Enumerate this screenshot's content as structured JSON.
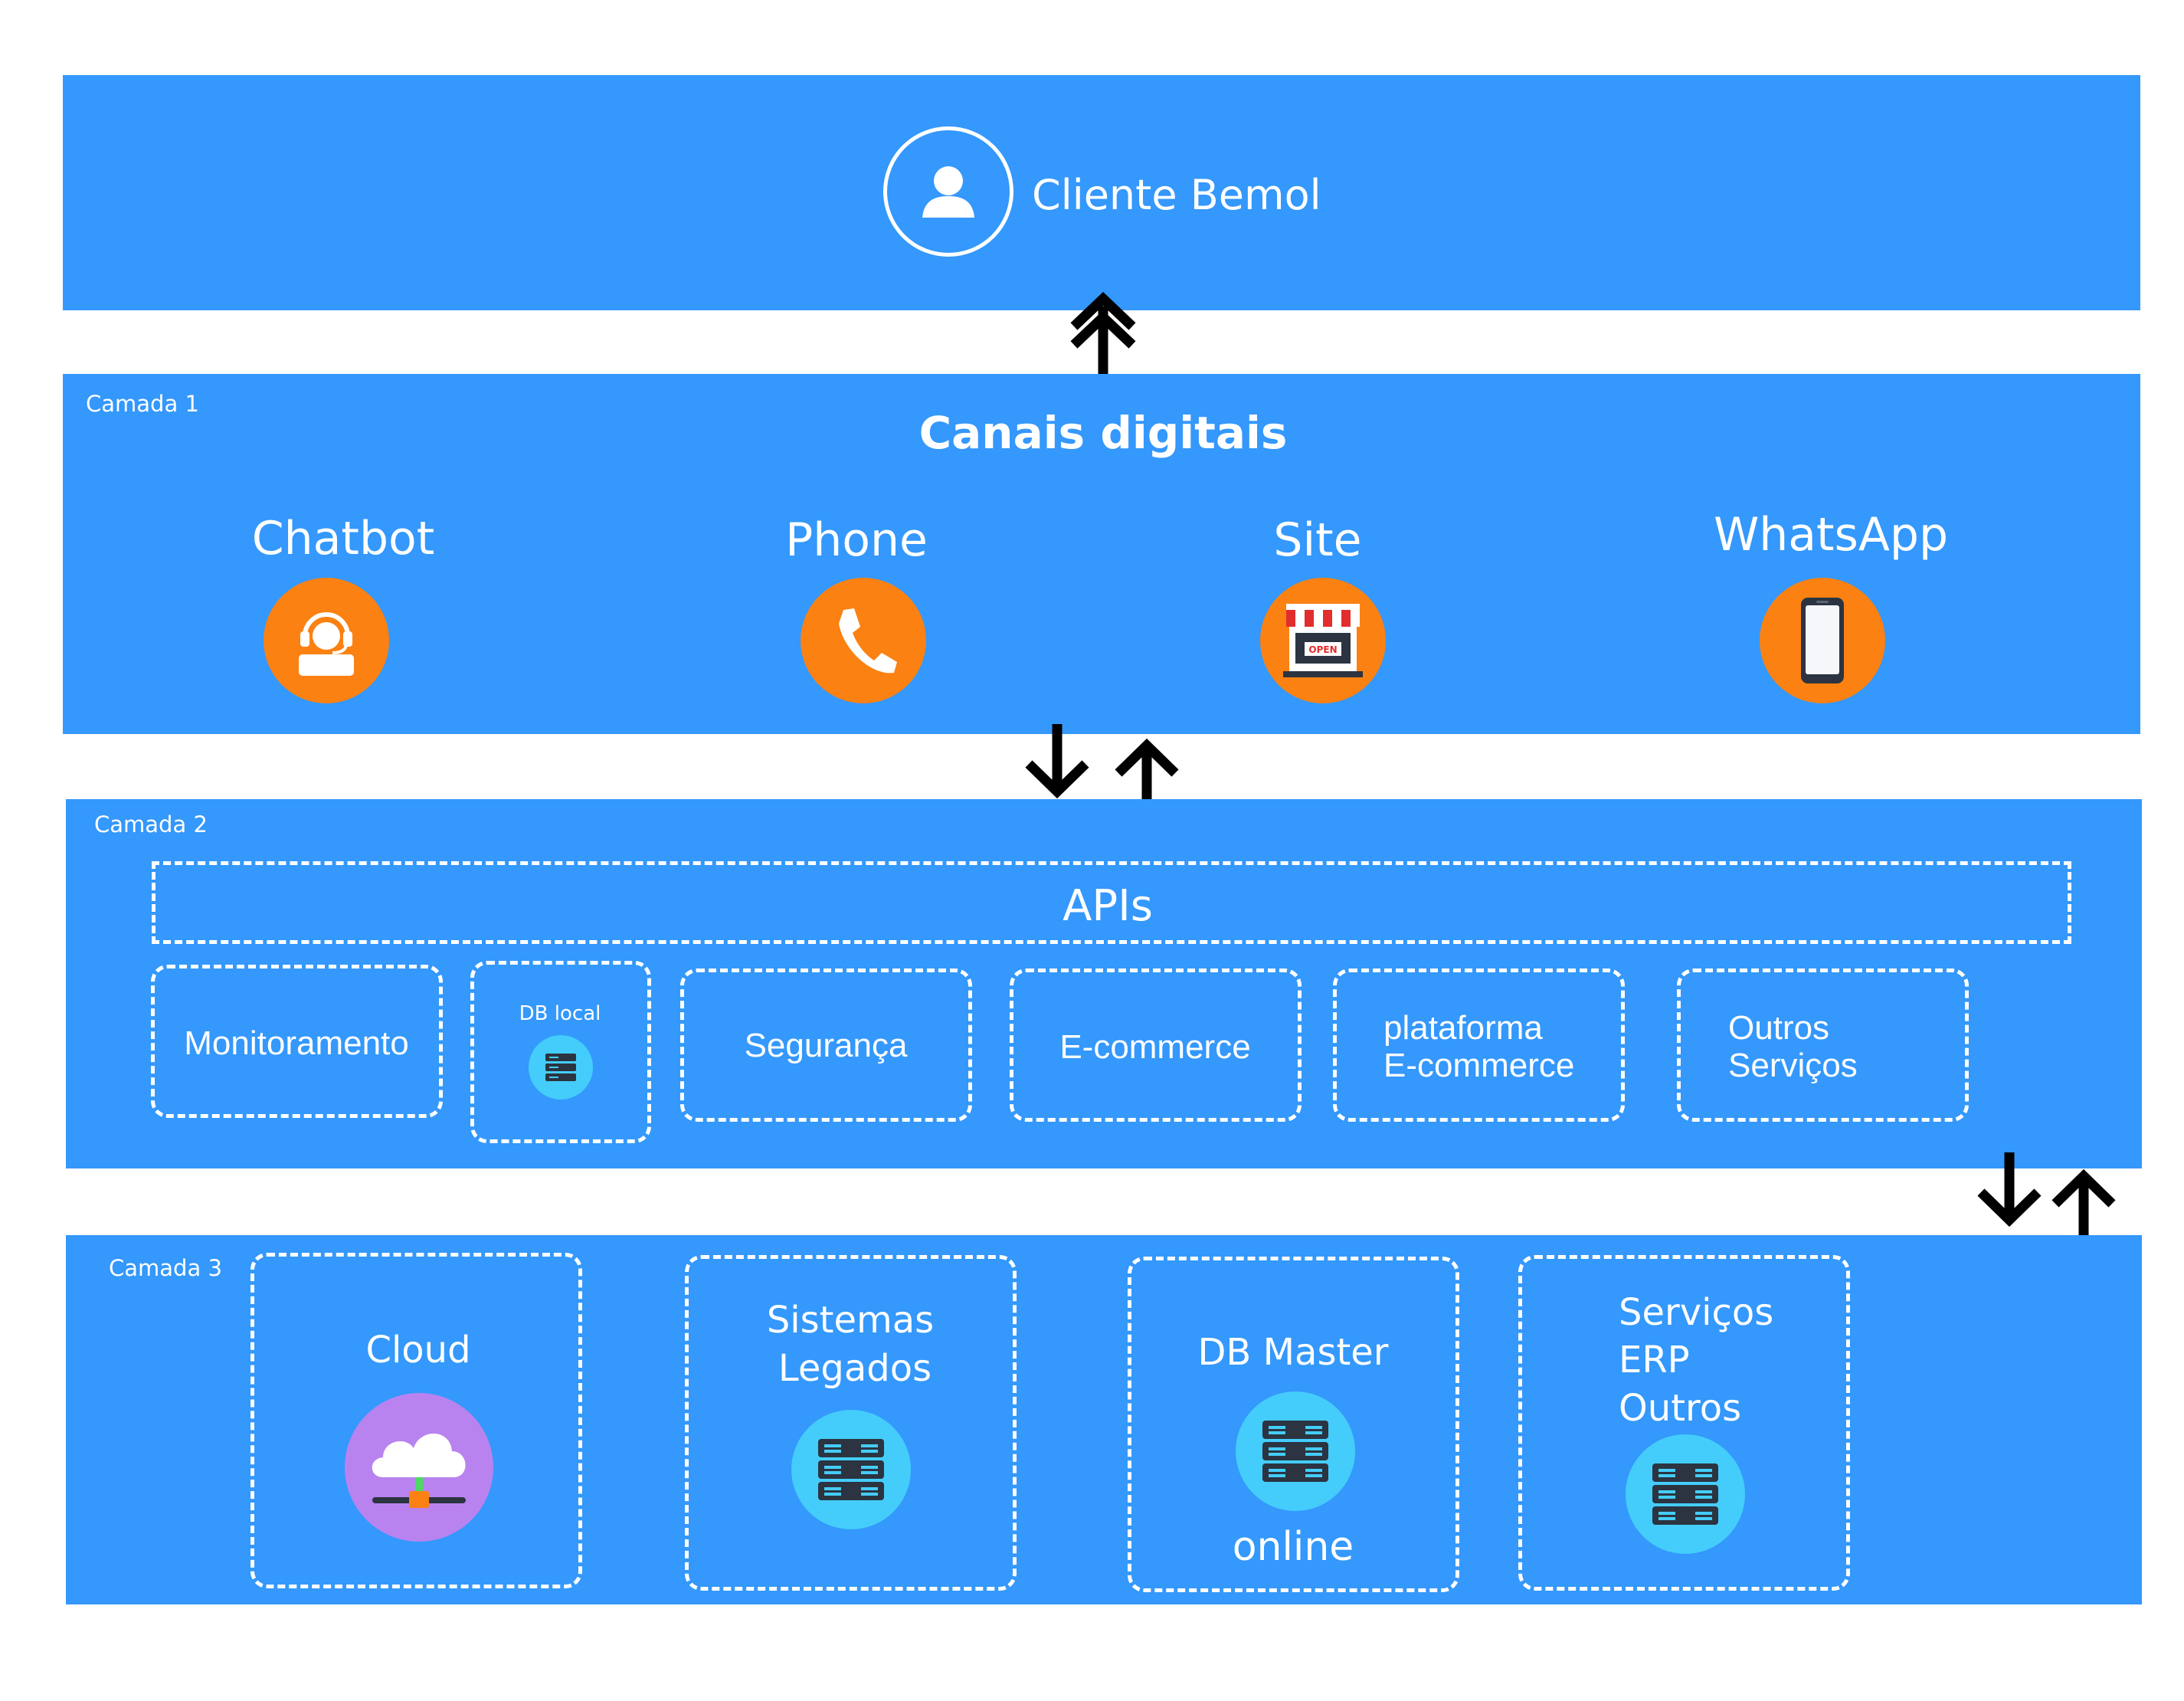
{
  "top": {
    "client_label": "Cliente Bemol"
  },
  "layer1": {
    "tag": "Camada 1",
    "title": "Canais digitais",
    "channels": [
      {
        "label": "Chatbot",
        "icon": "headset-agent-icon"
      },
      {
        "label": "Phone",
        "icon": "phone-icon"
      },
      {
        "label": "Site",
        "icon": "storefront-icon",
        "sign": "OPEN"
      },
      {
        "label": "WhatsApp",
        "icon": "smartphone-icon"
      }
    ]
  },
  "layer2": {
    "tag": "Camada 2",
    "apis_label": "APIs",
    "modules": {
      "monitoramento": "Monitoramento",
      "db_local": "DB local",
      "seguranca": "Segurança",
      "ecommerce": "E-commerce",
      "plataforma_line1": "plataforma",
      "plataforma_line2": "E-commerce",
      "outros_line1": "Outros",
      "outros_line2": "Serviços"
    }
  },
  "layer3": {
    "tag": "Camada 3",
    "cloud": "Cloud",
    "legados_line1": "Sistemas",
    "legados_line2": "Legados",
    "db_master": "DB Master",
    "db_master_status": "online",
    "erp_line1": "Serviços",
    "erp_line2": "ERP",
    "erp_line3": "Outros"
  },
  "colors": {
    "band": "#3498fc",
    "channel_icon_bg": "#fb8112",
    "server_icon_bg": "#44cdfb",
    "cloud_icon_bg": "#b883ef",
    "arrow": "#000000"
  }
}
